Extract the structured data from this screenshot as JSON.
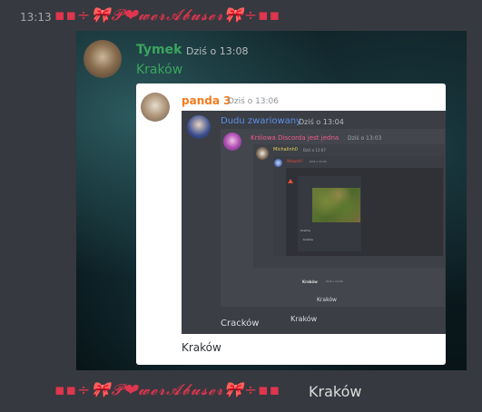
{
  "header": {
    "timestamp": "13:13",
    "display_name": "▪▪÷🎀𝓟❤𝔀𝓮𝓻𝓐𝓫𝓾𝓼𝓮𝓻🎀÷▪▪"
  },
  "embed": {
    "author": "Tymek",
    "time": "Dziś o 13:08",
    "message": "Kraków",
    "quote": {
      "author": "panda 3",
      "time": "Dziś o 13:06",
      "message": "Kraków",
      "quote": {
        "author": "Dudu zwariowany",
        "time": "Dziś o 13:04",
        "message": "Cracków",
        "quote": {
          "author": "Królowa Discorda jest jedna",
          "time": "Dziś o 13:03",
          "message": "Kraków",
          "quote": {
            "author": "Michalinh0",
            "time": "Dziś o 13:07",
            "message": "Kraków",
            "quote": {
              "author": "Wraunh?",
              "time": "Dziś o 13:00",
              "line": "Kraków",
              "footer_label": "Kraków",
              "footer_time": "Dziś o 13:00"
            }
          }
        }
      }
    }
  },
  "bottom": {
    "display_name": "▪▪÷🎀𝓟❤𝔀𝓮𝓻𝓐𝓫𝓾𝓼𝓮𝓻🎀÷▪▪",
    "message": "Kraków"
  }
}
